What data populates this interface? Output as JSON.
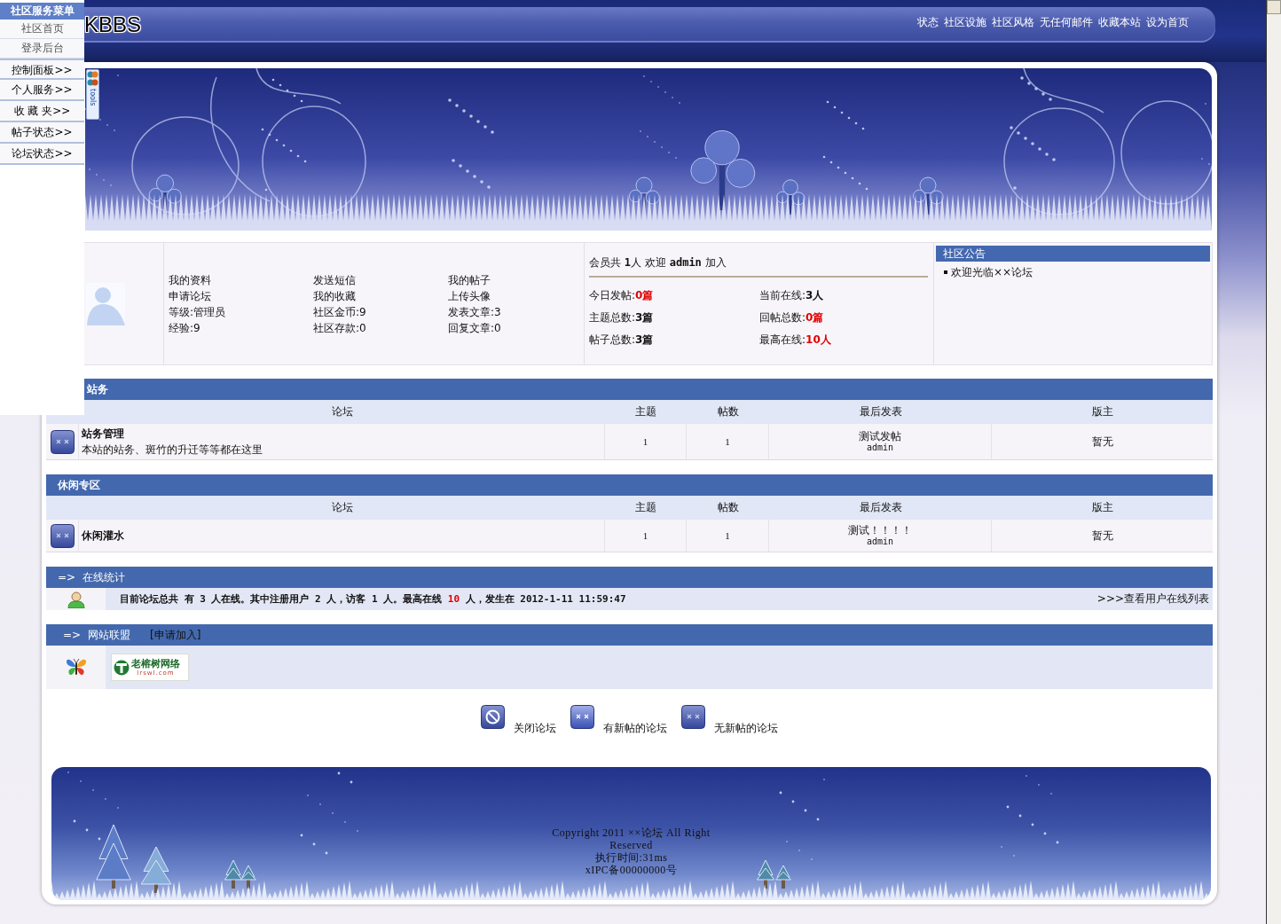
{
  "menu": {
    "title": "社区服务菜单",
    "items": [
      {
        "label": "社区首页",
        "kind": "link"
      },
      {
        "label": "登录后台",
        "kind": "link"
      },
      {
        "label": "控制面板>>",
        "kind": "group"
      },
      {
        "label": "个人服务>>",
        "kind": "group"
      },
      {
        "label": "收 藏 夹>>",
        "kind": "group"
      },
      {
        "label": "帖子状态>>",
        "kind": "group"
      },
      {
        "label": "论坛状态>>",
        "kind": "group"
      }
    ]
  },
  "header": {
    "logo": "KBBS",
    "nav": [
      "状态",
      "社区设施",
      "社区风格",
      "无任何邮件",
      "收藏本站",
      "设为首页"
    ]
  },
  "tools_tab": {
    "label": "tools"
  },
  "user_panel": {
    "columns": [
      {
        "links": [
          "我的资料",
          "申请论坛"
        ],
        "stats": [
          "等级:管理员",
          "经验:9"
        ]
      },
      {
        "links": [
          "发送短信",
          "我的收藏"
        ],
        "stats": [
          "社区金币:9",
          "社区存款:0"
        ]
      },
      {
        "links": [
          "我的帖子",
          "上传头像"
        ],
        "stats": [
          "发表文章:3",
          "回复文章:0"
        ]
      }
    ]
  },
  "site_stats": {
    "summary": "会员共 **1**人 欢迎 **admin** 加入",
    "items": [
      {
        "label": "今日发帖:",
        "value": "0篇",
        "highlight": true
      },
      {
        "label": "当前在线:",
        "value": "3人",
        "highlight": false
      },
      {
        "label": "主题总数:",
        "value": "3篇",
        "highlight": false
      },
      {
        "label": "回帖总数:",
        "value": "0篇",
        "highlight": true
      },
      {
        "label": "帖子总数:",
        "value": "3篇",
        "highlight": false
      },
      {
        "label": "最高在线:",
        "value": "10人",
        "highlight": true
      }
    ]
  },
  "announcement": {
    "title": "社区公告",
    "items": [
      "欢迎光临××论坛"
    ]
  },
  "categories": [
    {
      "title": "站务",
      "columns": [
        "论坛",
        "主题",
        "帖数",
        "最后发表",
        "版主"
      ],
      "forums": [
        {
          "name": "站务管理",
          "description": "本站的站务、斑竹的升迁等等都在这里",
          "topics": "1",
          "posts": "1",
          "last_post": {
            "title": "测试发帖",
            "author": "admin"
          },
          "moderator": "暂无"
        }
      ]
    },
    {
      "title": "休闲专区",
      "columns": [
        "论坛",
        "主题",
        "帖数",
        "最后发表",
        "版主"
      ],
      "forums": [
        {
          "name": "休闲灌水",
          "topics": "1",
          "posts": "1",
          "last_post": {
            "title": "测试！！！！",
            "author": "admin"
          },
          "moderator": "暂无"
        }
      ]
    }
  ],
  "online": {
    "title": "=>  在线统计",
    "summary_before": "目前论坛总共 有 3 人在线。其中注册用户 2 人，访客 1 人。最高在线 ",
    "peak": "10",
    "summary_after": " 人，发生在 2012-1-11 11:59:47",
    "list_link": ">>>查看用户在线列表"
  },
  "partners": {
    "title": "=>  网站联盟",
    "apply": "[申请加入]",
    "logos": [
      {
        "title": "老榕树网络",
        "domain": "lrswl.com"
      }
    ]
  },
  "legend": [
    {
      "kind": "closed",
      "label": "关闭论坛"
    },
    {
      "kind": "new",
      "label": "有新帖的论坛"
    },
    {
      "kind": "no_new",
      "label": "无新帖的论坛"
    }
  ],
  "footer": {
    "lines": [
      "Copyright 2011 ××论坛 All Right Reserved",
      "执行时间:31ms",
      "xIPC备00000000号"
    ]
  }
}
